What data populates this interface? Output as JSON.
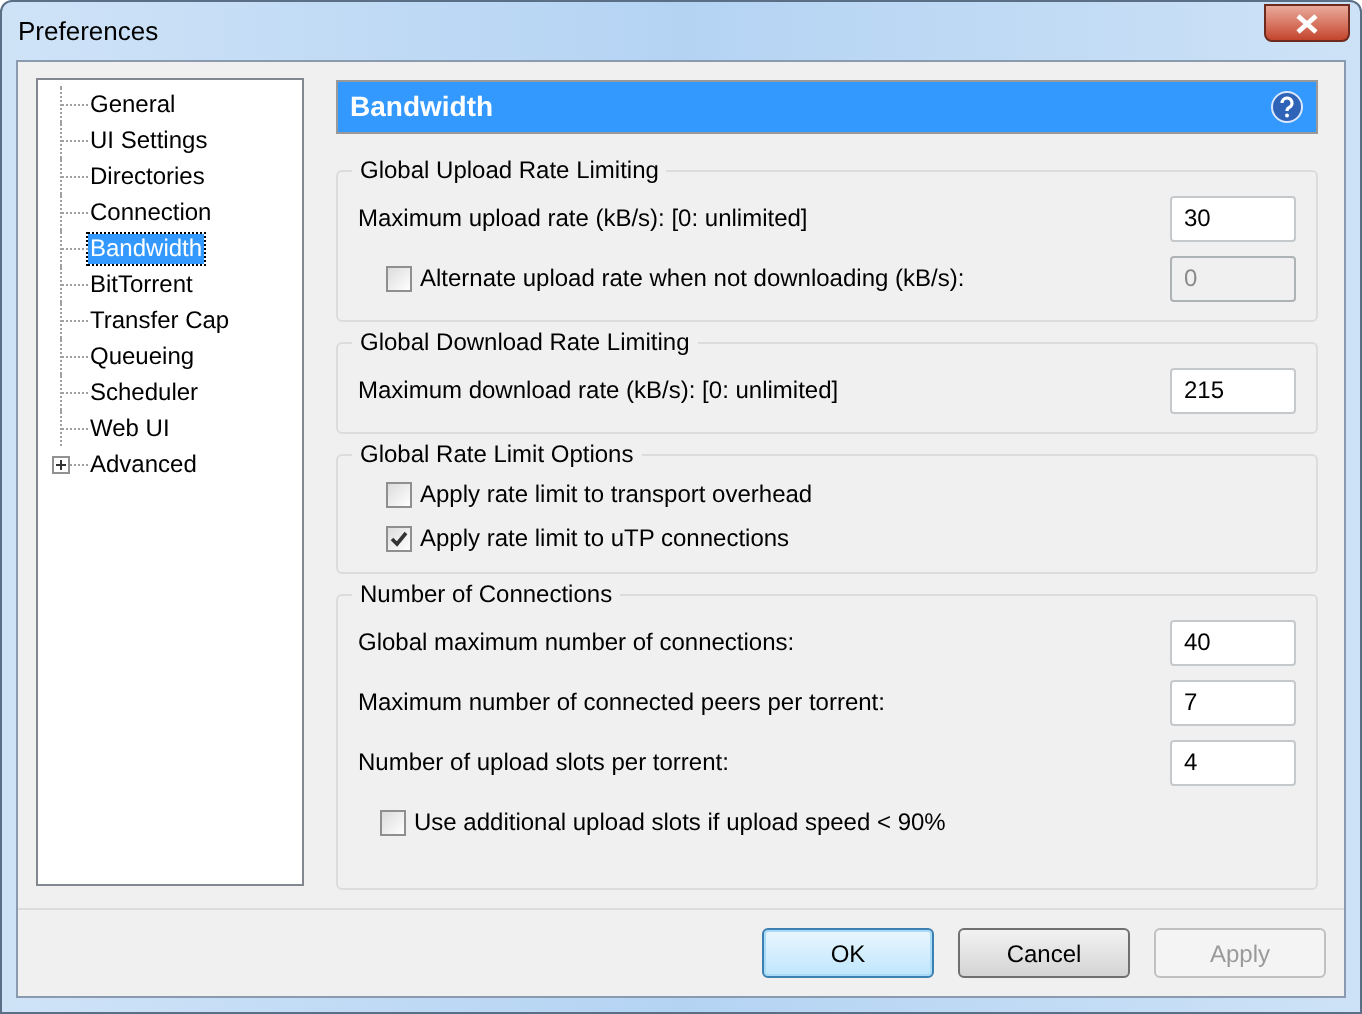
{
  "window": {
    "title": "Preferences"
  },
  "sidebar": {
    "items": [
      {
        "label": "General",
        "selected": false
      },
      {
        "label": "UI Settings",
        "selected": false
      },
      {
        "label": "Directories",
        "selected": false
      },
      {
        "label": "Connection",
        "selected": false
      },
      {
        "label": "Bandwidth",
        "selected": true
      },
      {
        "label": "BitTorrent",
        "selected": false
      },
      {
        "label": "Transfer Cap",
        "selected": false
      },
      {
        "label": "Queueing",
        "selected": false
      },
      {
        "label": "Scheduler",
        "selected": false
      },
      {
        "label": "Web UI",
        "selected": false
      },
      {
        "label": "Advanced",
        "selected": false,
        "expanded": false
      }
    ]
  },
  "panel": {
    "title": "Bandwidth",
    "groups": [
      {
        "title": "Global Upload Rate Limiting",
        "rows": [
          {
            "kind": "field",
            "label": "Maximum upload rate (kB/s): [0: unlimited]",
            "value": "30",
            "disabled": false
          },
          {
            "kind": "checkbox_field",
            "label": "Alternate upload rate when not downloading (kB/s):",
            "checked": false,
            "value": "0",
            "disabled": true
          }
        ]
      },
      {
        "title": "Global Download Rate Limiting",
        "rows": [
          {
            "kind": "field",
            "label": "Maximum download rate (kB/s): [0: unlimited]",
            "value": "215",
            "disabled": false
          }
        ]
      },
      {
        "title": "Global Rate Limit Options",
        "rows": [
          {
            "kind": "checkbox",
            "label": "Apply rate limit to transport overhead",
            "checked": false
          },
          {
            "kind": "checkbox",
            "label": "Apply rate limit to uTP connections",
            "checked": true
          }
        ]
      },
      {
        "title": "Number of Connections",
        "rows": [
          {
            "kind": "field",
            "label": "Global maximum number of connections:",
            "value": "40",
            "disabled": false
          },
          {
            "kind": "field",
            "label": "Maximum number of connected peers per torrent:",
            "value": "7",
            "disabled": false
          },
          {
            "kind": "field",
            "label": "Number of upload slots per torrent:",
            "value": "4",
            "disabled": false
          },
          {
            "kind": "checkbox",
            "label": "Use additional upload slots if upload speed < 90%",
            "checked": false,
            "indent": true
          }
        ]
      }
    ]
  },
  "buttons": [
    {
      "label": "OK",
      "default": true,
      "disabled": false
    },
    {
      "label": "Cancel",
      "default": false,
      "disabled": false
    },
    {
      "label": "Apply",
      "default": false,
      "disabled": true
    }
  ]
}
